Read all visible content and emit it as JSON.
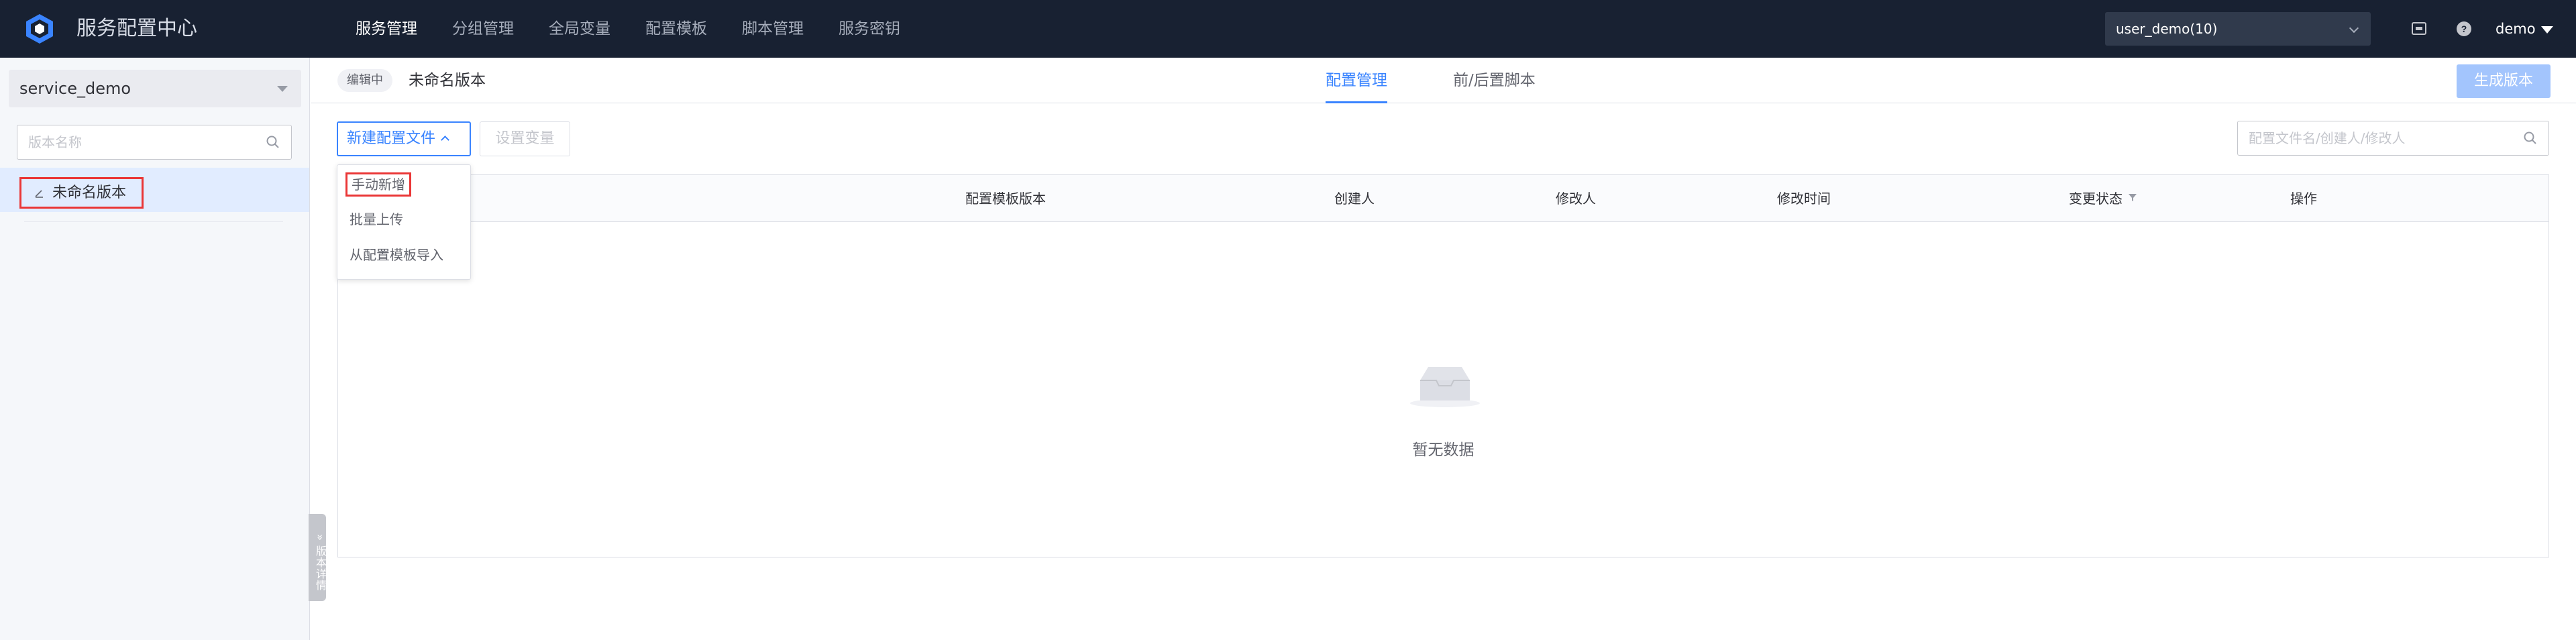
{
  "app": {
    "title": "服务配置中心"
  },
  "nav": {
    "items": [
      {
        "label": "服务管理",
        "active": true
      },
      {
        "label": "分组管理",
        "active": false
      },
      {
        "label": "全局变量",
        "active": false
      },
      {
        "label": "配置模板",
        "active": false
      },
      {
        "label": "脚本管理",
        "active": false
      },
      {
        "label": "服务密钥",
        "active": false
      }
    ]
  },
  "topbar": {
    "user_select_value": "user_demo(10)",
    "user_name": "demo"
  },
  "sidebar": {
    "service_select_value": "service_demo",
    "version_search_placeholder": "版本名称",
    "versions": [
      {
        "label": "未命名版本",
        "selected": true
      }
    ],
    "collapse_handle_label": "» 版本详情"
  },
  "main": {
    "status_tag": "编辑中",
    "title": "未命名版本",
    "tabs": [
      {
        "label": "配置管理",
        "active": true
      },
      {
        "label": "前/后置脚本",
        "active": false
      }
    ],
    "generate_button": "生成版本"
  },
  "toolbar": {
    "new_config_button": "新建配置文件",
    "set_variable_button": "设置变量",
    "search_placeholder": "配置文件名/创建人/修改人"
  },
  "dropdown": {
    "items": [
      {
        "label": "手动新增",
        "highlighted": true
      },
      {
        "label": "批量上传",
        "highlighted": false
      },
      {
        "label": "从配置模板导入",
        "highlighted": false
      }
    ]
  },
  "table": {
    "columns": [
      "配置模板版本",
      "创建人",
      "修改人",
      "修改时间",
      "变更状态",
      "操作"
    ],
    "empty_text": "暂无数据"
  },
  "colors": {
    "topbar_bg": "#182132",
    "accent": "#3a84ff",
    "highlight_border": "#ea3636",
    "selected_row": "#e1ecff"
  },
  "icons": {
    "logo": "hexagon-logo-icon",
    "screen": "screen-share-icon",
    "help": "help-circle-icon",
    "search": "search-icon",
    "edit": "pencil-icon",
    "filter": "filter-icon",
    "empty": "empty-box-icon"
  }
}
